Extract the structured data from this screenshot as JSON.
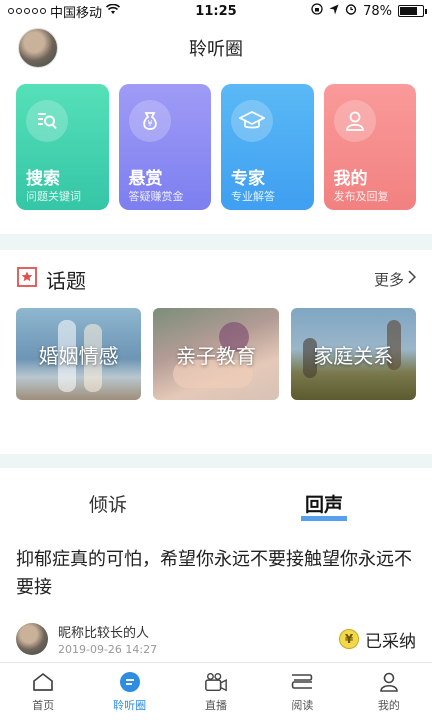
{
  "status_bar": {
    "carrier": "中国移动",
    "time": "11:25",
    "battery": "78%",
    "battery_level": 0.78
  },
  "header": {
    "title": "聆听圈"
  },
  "cards": [
    {
      "title": "搜索",
      "subtitle": "问题关键词",
      "icon": "search-icon"
    },
    {
      "title": "悬赏",
      "subtitle": "答疑赚赏金",
      "icon": "money-bag-icon"
    },
    {
      "title": "专家",
      "subtitle": "专业解答",
      "icon": "graduation-cap-icon"
    },
    {
      "title": "我的",
      "subtitle": "发布及回复",
      "icon": "person-icon"
    }
  ],
  "topics": {
    "title": "话题",
    "more": "更多",
    "items": [
      {
        "label": "婚姻情感"
      },
      {
        "label": "亲子教育"
      },
      {
        "label": "家庭关系"
      }
    ]
  },
  "tabs": {
    "complain": "倾诉",
    "echo": "回声"
  },
  "post": {
    "text": "抑郁症真的可怕，希望你永远不要接触望你永远不要接",
    "author": "昵称比较长的人",
    "time": "2019-09-26  14:27",
    "status": "已采纳",
    "coin_symbol": "¥"
  },
  "nav": [
    {
      "label": "首页",
      "icon": "home-icon"
    },
    {
      "label": "聆听圈",
      "icon": "chat-bubble-icon"
    },
    {
      "label": "直播",
      "icon": "video-camera-icon"
    },
    {
      "label": "阅读",
      "icon": "book-icon"
    },
    {
      "label": "我的",
      "icon": "person-icon"
    }
  ],
  "colors": {
    "accent": "#2e8de0",
    "card_green": "#35c6a7",
    "card_purple": "#7d7ff0",
    "card_blue": "#3f9ff1",
    "card_red": "#f28181"
  }
}
